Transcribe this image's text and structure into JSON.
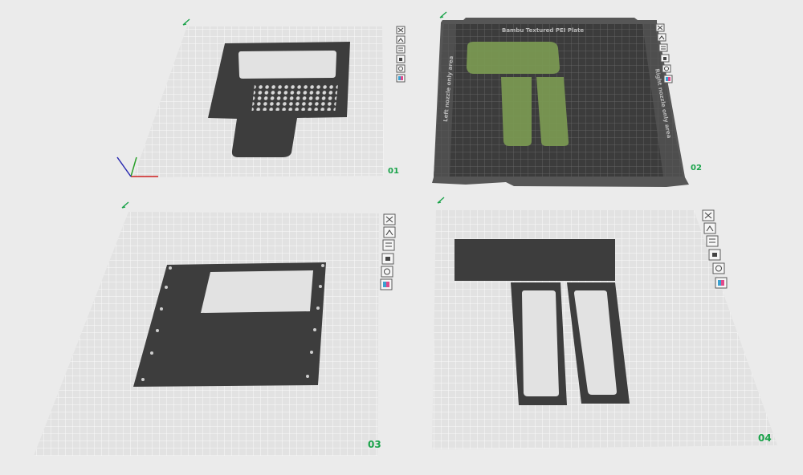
{
  "plates": [
    {
      "id": "plate-1",
      "number": "01",
      "bed": "default"
    },
    {
      "id": "plate-2",
      "number": "02",
      "bed": "textured",
      "bed_label": "Bambu Textured PEI Plate",
      "left_zone_label": "Left nozzle only area",
      "right_zone_label": "Right nozzle only area"
    },
    {
      "id": "plate-3",
      "number": "03",
      "bed": "default"
    },
    {
      "id": "plate-4",
      "number": "04",
      "bed": "default"
    }
  ],
  "toolbar_icons": [
    "close-icon",
    "arrange-icon",
    "slice-plate-icon",
    "lock-icon",
    "settings-icon",
    "filament-map-icon"
  ],
  "colors": {
    "background": "#ebebeb",
    "bed": "#e4e4e4",
    "grid_line": "#ffffff",
    "part": "#3d3d3d",
    "textured_bed": "#3a3a3a",
    "selected_part": "#7a9a52",
    "plate_number": "#1aa34a"
  }
}
